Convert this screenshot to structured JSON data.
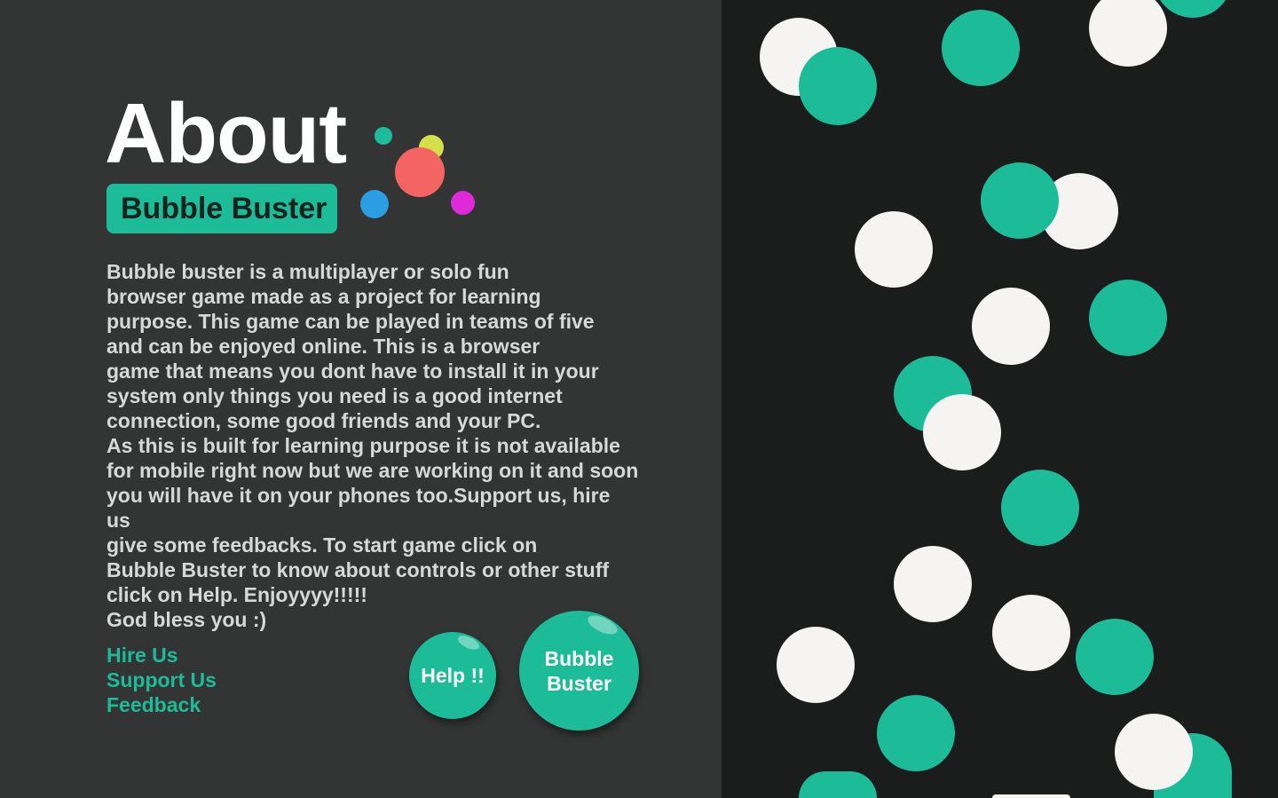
{
  "title": "About",
  "badge": "Bubble Buster",
  "description": "Bubble buster is a  multiplayer or solo fun\nbrowser game made as a project for learning\npurpose. This game can be played in teams of five\nand can be enjoyed online. This is a browser\ngame that means  you dont have to install it in your\nsystem only things you need is a good internet\nconnection, some good friends and your PC.\nAs this is built for learning purpose  it is not available\nfor mobile right now but we are working on it and soon\nyou will have it on your phones too.Support us, hire us\ngive some feedbacks.  To start game click on\nBubble Buster to know about controls or other stuff\nclick on Help. Enjoyyyy!!!!!\nGod bless you :)",
  "links": {
    "hire": "Hire Us",
    "support": "Support Us",
    "feedback": "Feedback"
  },
  "buttons": {
    "help": "Help !!",
    "play": "Bubble\nBuster"
  },
  "colors": {
    "accent": "#1cbc98",
    "left_background": "#333534",
    "right_background": "#1b1c1c",
    "bubble_white": "#f5f4f2",
    "logo_dots": [
      "#1cbc98",
      "#d4e04a",
      "#f36462",
      "#2b9de3",
      "#de2ad8"
    ]
  }
}
